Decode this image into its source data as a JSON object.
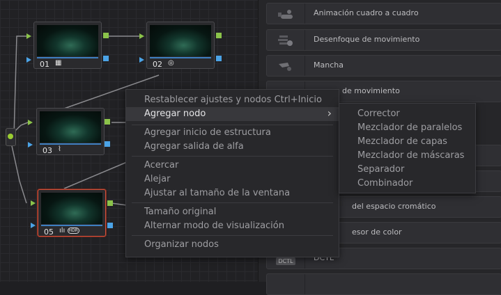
{
  "nodes": [
    {
      "number": "01",
      "icon": "grid-icon",
      "glyph": "▦"
    },
    {
      "number": "02",
      "icon": "saturation-icon",
      "glyph": "◎"
    },
    {
      "number": "03",
      "icon": "curves-icon",
      "glyph": "⌇"
    },
    {
      "number": "05",
      "icon": "hdr-icon",
      "glyph": "ılı",
      "badge": "HDR"
    }
  ],
  "fx_panel": {
    "items": [
      "Animación cuadro a cuadro",
      "Desenfoque de movimiento",
      "Mancha",
      "de movimiento",
      "del espacio cromático",
      "esor de color",
      "DCTL"
    ]
  },
  "context_menu": {
    "items": [
      {
        "label": "Restablecer ajustes y nodos",
        "shortcut": "Ctrl+Inicio"
      },
      {
        "label": "Agregar nodo",
        "arrow": "›"
      },
      {
        "label": "Agregar inicio de estructura"
      },
      {
        "label": "Agregar salida de alfa"
      },
      {
        "label": "Acercar"
      },
      {
        "label": "Alejar"
      },
      {
        "label": "Ajustar al tamaño de la ventana"
      },
      {
        "label": "Tamaño original"
      },
      {
        "label": "Alternar modo de visualización"
      },
      {
        "label": "Organizar nodos"
      }
    ]
  },
  "submenu": {
    "items": [
      "Corrector",
      "Mezclador de paralelos",
      "Mezclador de capas",
      "Mezclador de máscaras",
      "Separador",
      "Combinador"
    ]
  },
  "colors": {
    "accent_green": "#8bc34a",
    "accent_blue": "#4ba3e6",
    "selected_border": "#d0523c"
  }
}
